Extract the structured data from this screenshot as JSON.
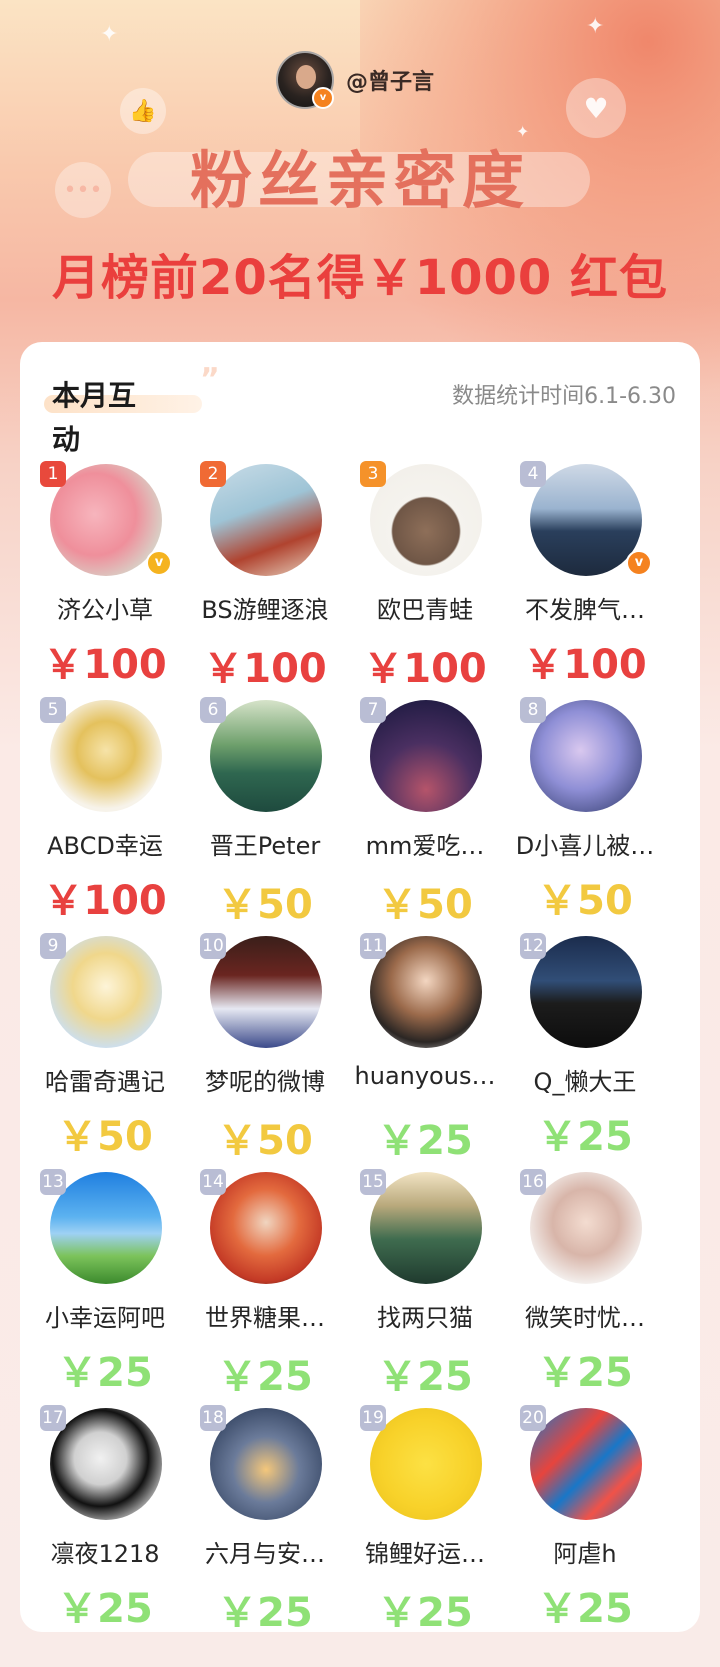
{
  "header": {
    "username": "@曾子言",
    "verified_icon": "verified-badge-icon"
  },
  "title": "粉丝亲密度",
  "subtitle": "月榜前20名得￥1000 红包",
  "card": {
    "label": "本月互动",
    "date_range": "数据统计时间6.1-6.30"
  },
  "colors": {
    "red": "#e8413f",
    "yellow": "#f2c940",
    "green": "#8fe176",
    "title": "#e4705d"
  },
  "ranking": [
    {
      "rank": "1",
      "name": "济公小草",
      "prize": "￥100",
      "tier": "red",
      "verified": "yellow"
    },
    {
      "rank": "2",
      "name": "BS游鲤逐浪",
      "prize": "￥100",
      "tier": "red",
      "verified": ""
    },
    {
      "rank": "3",
      "name": "欧巴青蛙",
      "prize": "￥100",
      "tier": "red",
      "verified": ""
    },
    {
      "rank": "4",
      "name": "不发脾气…",
      "prize": "￥100",
      "tier": "red",
      "verified": "orange"
    },
    {
      "rank": "5",
      "name": "ABCD幸运",
      "prize": "￥100",
      "tier": "red",
      "verified": ""
    },
    {
      "rank": "6",
      "name": "晋王Peter",
      "prize": "￥50",
      "tier": "yellow",
      "verified": ""
    },
    {
      "rank": "7",
      "name": "mm爱吃…",
      "prize": "￥50",
      "tier": "yellow",
      "verified": ""
    },
    {
      "rank": "8",
      "name": "D小喜儿被…",
      "prize": "￥50",
      "tier": "yellow",
      "verified": ""
    },
    {
      "rank": "9",
      "name": "哈雷奇遇记",
      "prize": "￥50",
      "tier": "yellow",
      "verified": ""
    },
    {
      "rank": "10",
      "name": "梦呢的微博",
      "prize": "￥50",
      "tier": "yellow",
      "verified": ""
    },
    {
      "rank": "11",
      "name": "huanyous…",
      "prize": "￥25",
      "tier": "green",
      "verified": ""
    },
    {
      "rank": "12",
      "name": "Q_懒大王",
      "prize": "￥25",
      "tier": "green",
      "verified": ""
    },
    {
      "rank": "13",
      "name": "小幸运阿吧",
      "prize": "￥25",
      "tier": "green",
      "verified": ""
    },
    {
      "rank": "14",
      "name": "世界糖果…",
      "prize": "￥25",
      "tier": "green",
      "verified": ""
    },
    {
      "rank": "15",
      "name": "找两只猫",
      "prize": "￥25",
      "tier": "green",
      "verified": ""
    },
    {
      "rank": "16",
      "name": "微笑时忧…",
      "prize": "￥25",
      "tier": "green",
      "verified": ""
    },
    {
      "rank": "17",
      "name": "凛夜1218",
      "prize": "￥25",
      "tier": "green",
      "verified": ""
    },
    {
      "rank": "18",
      "name": "六月与安…",
      "prize": "￥25",
      "tier": "green",
      "verified": ""
    },
    {
      "rank": "19",
      "name": "锦鲤好运…",
      "prize": "￥25",
      "tier": "green",
      "verified": ""
    },
    {
      "rank": "20",
      "name": "阿虐h",
      "prize": "￥25",
      "tier": "green",
      "verified": ""
    }
  ]
}
